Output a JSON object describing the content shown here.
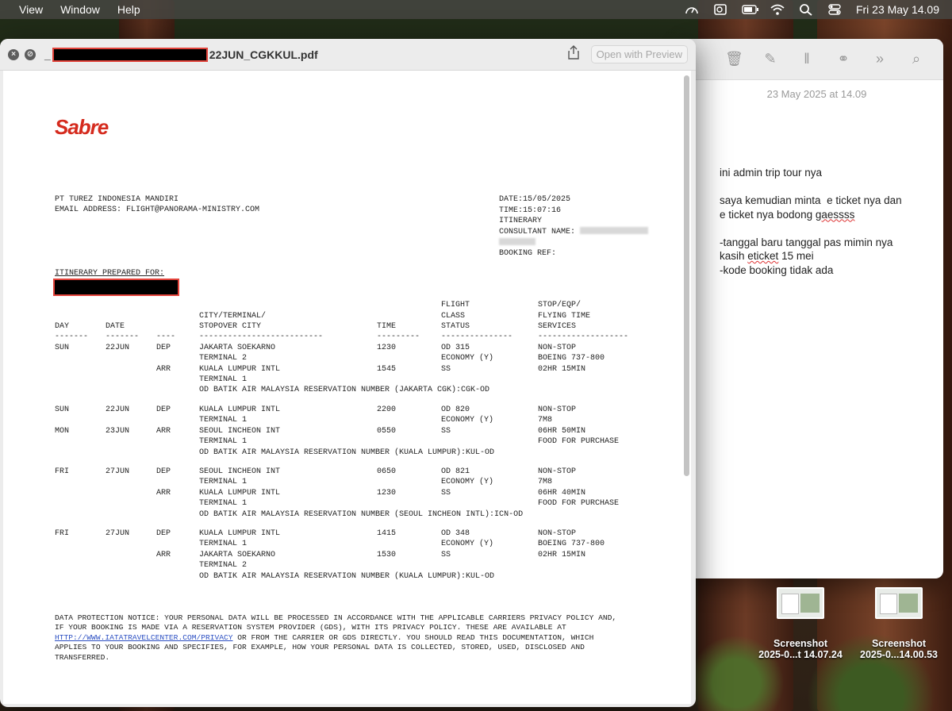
{
  "menubar": {
    "items": [
      "View",
      "Window",
      "Help"
    ],
    "clock": "Fri 23 May  14.09"
  },
  "quicklook": {
    "title_prefix": "_",
    "title_suffix": "22JUN_CGKKUL.pdf",
    "open_button": "Open with Preview"
  },
  "pdf": {
    "logo": "Sabre",
    "agency_lines": [
      "PT TUREZ INDONESIA MANDIRI",
      "EMAIL ADDRESS: FLIGHT@PANORAMA-MINISTRY.COM"
    ],
    "date": "DATE:15/05/2025",
    "time": "TIME:15:07:16",
    "itinerary": "ITINERARY",
    "consultant": "CONSULTANT NAME:",
    "booking_ref": "BOOKING REF:",
    "prepared_for": "ITINERARY PREPARED FOR:",
    "header": {
      "day": "DAY",
      "date": "DATE",
      "city": "CITY/TERMINAL/\nSTOPOVER CITY",
      "time": "TIME",
      "flight": "FLIGHT\nCLASS\nSTATUS",
      "stop": "STOP/EQP/\nFLYING TIME\nSERVICES",
      "dashes": [
        "-------",
        "-------",
        "----",
        "--------------------------",
        "---------",
        "---------------",
        "-------------------"
      ]
    },
    "segments": [
      {
        "day": "SUN",
        "date": "22JUN",
        "act": "DEP\n\nARR",
        "city": "JAKARTA SOEKARNO\nTERMINAL 2\nKUALA LUMPUR INTL\nTERMINAL 1\nOD BATIK AIR MALAYSIA RESERVATION NUMBER (JAKARTA CGK):CGK-OD",
        "time": "1230\n\n1545",
        "flight": "OD 315\nECONOMY (Y)\nSS",
        "stop": "NON-STOP\nBOEING 737-800\n02HR 15MIN"
      },
      {
        "day": "SUN\n\nMON",
        "date": "22JUN\n\n23JUN",
        "act": "DEP\n\nARR",
        "city": "KUALA LUMPUR INTL\nTERMINAL 1\nSEOUL INCHEON INT\nTERMINAL 1\nOD BATIK AIR MALAYSIA RESERVATION NUMBER (KUALA LUMPUR):KUL-OD",
        "time": "2200\n\n0550",
        "flight": "OD 820\nECONOMY (Y)\nSS",
        "stop": "NON-STOP\n7M8\n06HR 50MIN\nFOOD FOR PURCHASE"
      },
      {
        "day": "FRI",
        "date": "27JUN",
        "act": "DEP\n\nARR",
        "city": "SEOUL INCHEON INT\nTERMINAL 1\nKUALA LUMPUR INTL\nTERMINAL 1\nOD BATIK AIR MALAYSIA RESERVATION NUMBER (SEOUL INCHEON INTL):ICN-OD",
        "time": "0650\n\n1230",
        "flight": "OD 821\nECONOMY (Y)\nSS",
        "stop": "NON-STOP\n7M8\n06HR 40MIN\nFOOD FOR PURCHASE"
      },
      {
        "day": "FRI",
        "date": "27JUN",
        "act": "DEP\n\nARR",
        "city": "KUALA LUMPUR INTL\nTERMINAL 1\nJAKARTA SOEKARNO\nTERMINAL 2\nOD BATIK AIR MALAYSIA RESERVATION NUMBER (KUALA LUMPUR):KUL-OD",
        "time": "1415\n\n1530",
        "flight": "OD 348\nECONOMY (Y)\nSS",
        "stop": "NON-STOP\nBOEING 737-800\n02HR 15MIN"
      }
    ],
    "notice_before_link": "DATA PROTECTION NOTICE: YOUR PERSONAL DATA WILL BE PROCESSED IN ACCORDANCE WITH THE APPLICABLE CARRIERS PRIVACY POLICY AND,\nIF YOUR BOOKING IS MADE VIA A RESERVATION SYSTEM PROVIDER (GDS), WITH ITS PRIVACY POLICY. THESE ARE AVAILABLE AT\n",
    "notice_link": "HTTP://WWW.IATATRAVELCENTER.COM/PRIVACY",
    "notice_after_link": " OR FROM THE CARRIER OR GDS DIRECTLY. YOU SHOULD READ THIS DOCUMENTATION, WHICH\nAPPLIES TO YOUR BOOKING AND SPECIFIES, FOR EXAMPLE, HOW YOUR PERSONAL DATA IS COLLECTED, STORED, USED, DISCLOSED AND\nTRANSFERRED."
  },
  "notes": {
    "date": "23 May 2025 at 14.09",
    "line1": "ini admin trip tour nya",
    "line2a": "saya kemudian minta  e ticket nya dan",
    "line2b": "e ticket nya bodong ",
    "line2b_wavy": "gaessss",
    "line3a": "-tanggal baru tanggal pas mimin nya",
    "line3b_pre": "kasih ",
    "line3b_wavy": "eticket",
    "line3b_post": " 15 mei",
    "line4": "-kode booking tidak ada"
  },
  "desktop": {
    "icons": [
      {
        "name": "Screenshot",
        "sub": "2025-0...t 14.07.24"
      },
      {
        "name": "Screenshot",
        "sub": "2025-0...14.00.53"
      }
    ]
  }
}
